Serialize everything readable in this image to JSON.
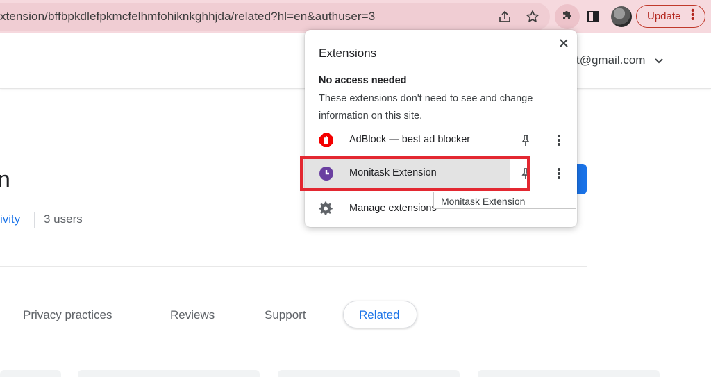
{
  "browser": {
    "url": "xtension/bffbpkdlefpkmcfelhmfohiknkghhjda/related?hl=en&authuser=3",
    "update_label": "Update",
    "icons": [
      "share-icon",
      "star-icon",
      "puzzle-icon",
      "side-panel-icon",
      "avatar",
      "kebab-icon"
    ]
  },
  "page": {
    "account": "t@gmail.com",
    "title_fragment": "n",
    "category_fragment": "ivity",
    "users": "3 users",
    "tabs": [
      {
        "label": "Privacy practices"
      },
      {
        "label": "Reviews"
      },
      {
        "label": "Support"
      },
      {
        "label": "Related"
      }
    ]
  },
  "popup": {
    "title": "Extensions",
    "section_heading": "No access needed",
    "section_desc": "These extensions don't need to see and change information on this site.",
    "items": [
      {
        "name": "AdBlock — best ad blocker",
        "icon": "adblock-icon"
      },
      {
        "name": "Monitask Extension",
        "icon": "monitask-icon"
      }
    ],
    "manage_label": "Manage extensions",
    "tooltip": "Monitask Extension"
  },
  "colors": {
    "toolbar": "#f6d9de",
    "accent_blue": "#1a73e8",
    "update_red": "#b3261e",
    "highlight_red": "#e32831",
    "adblock_red": "#f40000",
    "monitask_purple": "#6a3fa0"
  }
}
